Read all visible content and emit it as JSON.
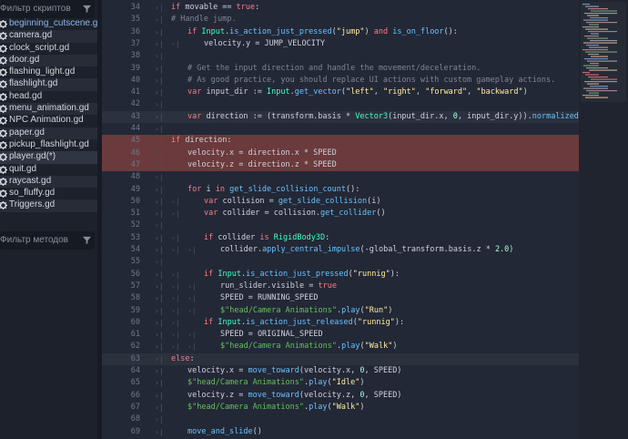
{
  "sidebar": {
    "script_filter_placeholder": "Фильтр скриптов",
    "method_filter_placeholder": "Фильтр методов",
    "files": [
      {
        "name": "beginning_cutscene.gd",
        "highlight": true
      },
      {
        "name": "camera.gd"
      },
      {
        "name": "clock_script.gd"
      },
      {
        "name": "door.gd"
      },
      {
        "name": "flashing_light.gd"
      },
      {
        "name": "flashlight.gd"
      },
      {
        "name": "head.gd"
      },
      {
        "name": "menu_animation.gd"
      },
      {
        "name": "NPC Animation.gd"
      },
      {
        "name": "paper.gd"
      },
      {
        "name": "pickup_flashlight.gd"
      },
      {
        "name": "player.gd(*)",
        "active": true
      },
      {
        "name": "quit.gd"
      },
      {
        "name": "raycast.gd"
      },
      {
        "name": "so_fluffy.gd"
      },
      {
        "name": "Triggers.gd"
      }
    ],
    "file_icon": "gear-icon",
    "filter_icon": "funnel-icon"
  },
  "editor": {
    "highlight_colors": {
      "error_line": "#6b3a3c",
      "current_line": "#2b313d"
    },
    "lines": [
      {
        "n": "34",
        "indent": 0,
        "tokens": [
          [
            "kw",
            "if "
          ],
          [
            "",
            "movable == "
          ],
          [
            "kw",
            "true"
          ],
          [
            "",
            ":"
          ]
        ]
      },
      {
        "n": "35",
        "indent": 0,
        "tokens": [
          [
            "cmt",
            "# Handle jump."
          ]
        ]
      },
      {
        "n": "36",
        "indent": 1,
        "tokens": [
          [
            "kw",
            "if "
          ],
          [
            "ty",
            "Input"
          ],
          [
            "",
            "."
          ],
          [
            "fn",
            "is_action_just_pressed"
          ],
          [
            "",
            "("
          ],
          [
            "str",
            "\"jump\""
          ],
          [
            "",
            ") "
          ],
          [
            "kw",
            "and "
          ],
          [
            "fn",
            "is_on_floor"
          ],
          [
            "",
            "():"
          ]
        ]
      },
      {
        "n": "37",
        "indent": 2,
        "tokens": [
          [
            "",
            "velocity.y = JUMP_VELOCITY"
          ]
        ]
      },
      {
        "n": "38",
        "indent": 0,
        "tokens": []
      },
      {
        "n": "39",
        "indent": 1,
        "tokens": [
          [
            "cmt",
            "# Get the input direction and handle the movement/deceleration."
          ]
        ]
      },
      {
        "n": "40",
        "indent": 1,
        "tokens": [
          [
            "cmt",
            "# As good practice, you should replace UI actions with custom gameplay actions."
          ]
        ]
      },
      {
        "n": "41",
        "indent": 1,
        "tokens": [
          [
            "kw",
            "var "
          ],
          [
            "",
            "input_dir := "
          ],
          [
            "ty",
            "Input"
          ],
          [
            "",
            "."
          ],
          [
            "fn",
            "get_vector"
          ],
          [
            "",
            "("
          ],
          [
            "str",
            "\"left\""
          ],
          [
            "",
            ", "
          ],
          [
            "str",
            "\"right\""
          ],
          [
            "",
            ", "
          ],
          [
            "str",
            "\"forward\""
          ],
          [
            "",
            ", "
          ],
          [
            "str",
            "\"backward\""
          ],
          [
            "",
            ")"
          ]
        ]
      },
      {
        "n": "42",
        "indent": 0,
        "tokens": []
      },
      {
        "n": "43",
        "indent": 1,
        "hl": "cur",
        "tokens": [
          [
            "kw",
            "var "
          ],
          [
            "",
            "direction := (transform.basis * "
          ],
          [
            "ty",
            "Vector3"
          ],
          [
            "",
            "(input_dir.x, "
          ],
          [
            "num",
            "0"
          ],
          [
            "",
            ", input_dir.y))."
          ],
          [
            "fn",
            "normalized"
          ],
          [
            "",
            "()"
          ]
        ]
      },
      {
        "n": "44",
        "indent": 0,
        "tokens": []
      },
      {
        "n": "45",
        "indent": 0,
        "hl": "red",
        "tokens": [
          [
            "kw",
            "if "
          ],
          [
            "",
            "direction:"
          ]
        ]
      },
      {
        "n": "46",
        "indent": 1,
        "hl": "red",
        "tokens": [
          [
            "",
            "velocity.x = direction.x * SPEED"
          ]
        ]
      },
      {
        "n": "47",
        "indent": 1,
        "hl": "red",
        "tokens": [
          [
            "",
            "velocity.z = direction.z * SPEED"
          ]
        ]
      },
      {
        "n": "48",
        "indent": 0,
        "tokens": []
      },
      {
        "n": "49",
        "indent": 1,
        "tokens": [
          [
            "kw",
            "for "
          ],
          [
            "",
            "i "
          ],
          [
            "kw",
            "in "
          ],
          [
            "fn",
            "get_slide_collision_count"
          ],
          [
            "",
            "():"
          ]
        ]
      },
      {
        "n": "50",
        "indent": 2,
        "tokens": [
          [
            "kw",
            "var "
          ],
          [
            "",
            "collision = "
          ],
          [
            "fn",
            "get_slide_collision"
          ],
          [
            "",
            "(i)"
          ]
        ]
      },
      {
        "n": "51",
        "indent": 2,
        "tokens": [
          [
            "kw",
            "var "
          ],
          [
            "",
            "collider = collision."
          ],
          [
            "fn",
            "get_collider"
          ],
          [
            "",
            "()"
          ]
        ]
      },
      {
        "n": "52",
        "indent": 0,
        "tokens": []
      },
      {
        "n": "53",
        "indent": 2,
        "tokens": [
          [
            "kw",
            "if "
          ],
          [
            "",
            "collider "
          ],
          [
            "kw",
            "is "
          ],
          [
            "ty",
            "RigidBody3D"
          ],
          [
            "",
            ":"
          ]
        ]
      },
      {
        "n": "54",
        "indent": 3,
        "tokens": [
          [
            "",
            "collider."
          ],
          [
            "fn",
            "apply_central_impulse"
          ],
          [
            "",
            "(-global_transform.basis.z * "
          ],
          [
            "num",
            "2.0"
          ],
          [
            "",
            ")"
          ]
        ]
      },
      {
        "n": "55",
        "indent": 0,
        "tokens": []
      },
      {
        "n": "56",
        "indent": 2,
        "tokens": [
          [
            "kw",
            "if "
          ],
          [
            "ty",
            "Input"
          ],
          [
            "",
            "."
          ],
          [
            "fn",
            "is_action_just_pressed"
          ],
          [
            "",
            "("
          ],
          [
            "str",
            "\"runnig\""
          ],
          [
            "",
            "):"
          ]
        ]
      },
      {
        "n": "57",
        "indent": 3,
        "tokens": [
          [
            "",
            "run_slider.visible = "
          ],
          [
            "kw",
            "true"
          ]
        ]
      },
      {
        "n": "58",
        "indent": 3,
        "tokens": [
          [
            "",
            "SPEED = RUNNING_SPEED"
          ]
        ]
      },
      {
        "n": "59",
        "indent": 3,
        "tokens": [
          [
            "np",
            "$\"head/Camera Animations\""
          ],
          [
            "",
            "."
          ],
          [
            "fn",
            "play"
          ],
          [
            "",
            "("
          ],
          [
            "str",
            "\"Run\""
          ],
          [
            "",
            ")"
          ]
        ]
      },
      {
        "n": "60",
        "indent": 2,
        "tokens": [
          [
            "kw",
            "if "
          ],
          [
            "ty",
            "Input"
          ],
          [
            "",
            "."
          ],
          [
            "fn",
            "is_action_just_released"
          ],
          [
            "",
            "("
          ],
          [
            "str",
            "\"runnig\""
          ],
          [
            "",
            "):"
          ]
        ]
      },
      {
        "n": "61",
        "indent": 3,
        "tokens": [
          [
            "",
            "SPEED = ORIGINAL_SPEED"
          ]
        ]
      },
      {
        "n": "62",
        "indent": 3,
        "tokens": [
          [
            "np",
            "$\"head/Camera Animations\""
          ],
          [
            "",
            "."
          ],
          [
            "fn",
            "play"
          ],
          [
            "",
            "("
          ],
          [
            "str",
            "\"Walk\""
          ],
          [
            "",
            ")"
          ]
        ]
      },
      {
        "n": "63",
        "indent": 0,
        "hl": "cur",
        "tokens": [
          [
            "kw",
            "else"
          ],
          [
            "",
            ":"
          ]
        ]
      },
      {
        "n": "64",
        "indent": 1,
        "tokens": [
          [
            "",
            "velocity.x = "
          ],
          [
            "fn",
            "move_toward"
          ],
          [
            "",
            "(velocity.x, "
          ],
          [
            "num",
            "0"
          ],
          [
            "",
            ", SPEED)"
          ]
        ]
      },
      {
        "n": "65",
        "indent": 1,
        "tokens": [
          [
            "np",
            "$\"head/Camera Animations\""
          ],
          [
            "",
            "."
          ],
          [
            "fn",
            "play"
          ],
          [
            "",
            "("
          ],
          [
            "str",
            "\"Idle\""
          ],
          [
            "",
            ")"
          ]
        ]
      },
      {
        "n": "66",
        "indent": 1,
        "tokens": [
          [
            "",
            "velocity.z = "
          ],
          [
            "fn",
            "move_toward"
          ],
          [
            "",
            "(velocity.z, "
          ],
          [
            "num",
            "0"
          ],
          [
            "",
            ", SPEED)"
          ]
        ]
      },
      {
        "n": "67",
        "indent": 1,
        "tokens": [
          [
            "np",
            "$\"head/Camera Animations\""
          ],
          [
            "",
            "."
          ],
          [
            "fn",
            "play"
          ],
          [
            "",
            "("
          ],
          [
            "str",
            "\"Walk\""
          ],
          [
            "",
            ")"
          ]
        ]
      },
      {
        "n": "68",
        "indent": 0,
        "tokens": []
      },
      {
        "n": "69",
        "indent": 1,
        "tokens": [
          [
            "fn",
            "move_and_slide"
          ],
          [
            "",
            "()"
          ]
        ]
      }
    ]
  }
}
